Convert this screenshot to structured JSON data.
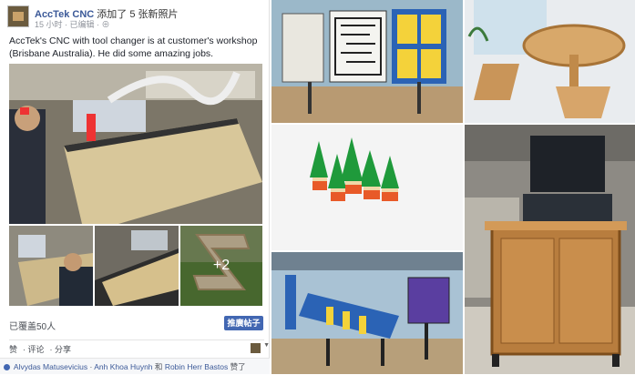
{
  "post": {
    "page_name": "AccTek CNC",
    "action_text": "添加了 5 张新照片",
    "time": "15 小时",
    "edited": "已编辑",
    "caption": "AccTek's CNC with tool changer is at customer's workshop (Brisbane Australia). He did some amazing jobs.",
    "more_photos": "+2",
    "reach": "已覆盖50人",
    "boost_label": "推廣帖子",
    "actions": [
      "赞",
      "评论",
      "分享"
    ],
    "likers": {
      "name1": "Alvydas Matusevicius",
      "name2": "Anh Khoa Huynh",
      "conj": "和",
      "name3": "Robin Herr Bastos",
      "suffix": "赞了"
    }
  },
  "colors": {
    "link": "#3b5998",
    "boost": "#4267b2"
  },
  "icons": [
    "page-avatar",
    "globe-icon",
    "like-icon",
    "caret-down-icon"
  ]
}
